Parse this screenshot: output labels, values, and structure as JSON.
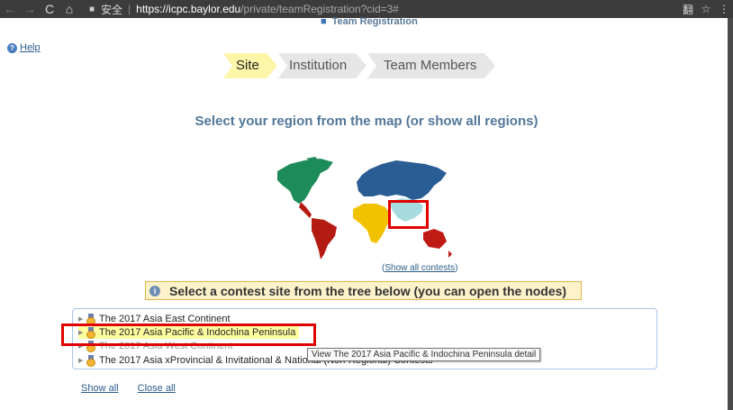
{
  "browser": {
    "secure_label": "安全",
    "url_host": "https://icpc.baylor.edu",
    "url_path": "/private/teamRegistration?cid=3#",
    "back_icon": "←",
    "forward_icon": "→",
    "reload_icon": "C",
    "home_icon": "⌂",
    "lock_icon": "🔒",
    "translate_icon": "翻",
    "star_icon": "☆",
    "menu_icon": "⋮"
  },
  "page": {
    "overlay_title": "Team Registration",
    "help_label": "Help"
  },
  "steps": [
    {
      "label": "Site",
      "active": true
    },
    {
      "label": "Institution",
      "active": false
    },
    {
      "label": "Team Members",
      "active": false
    }
  ],
  "region": {
    "heading": "Select your region from the map (or show all regions)",
    "show_all_contests_open": "(",
    "show_all_contests_link": "Show all contests",
    "show_all_contests_close": ")"
  },
  "info": {
    "text": "Select a contest site from the tree below (you can open the nodes)"
  },
  "tree": {
    "items": [
      {
        "label": "The 2017 Asia East Continent"
      },
      {
        "label": "The 2017 Asia Pacific & Indochina Peninsula"
      },
      {
        "label": "The 2017 Asia West Continent"
      },
      {
        "label": "The 2017 Asia xProvincial & Invitational & National (Non-Regional) Contests"
      }
    ],
    "tooltip": "View The 2017 Asia Pacific & Indochina Peninsula detail"
  },
  "links": {
    "show_all": "Show all",
    "close_all": "Close all"
  },
  "colors": {
    "map_north_america": "#1e8c5a",
    "map_south_america": "#b41b12",
    "map_europe_asia": "#2b5d95",
    "map_africa": "#f2c200",
    "map_southeast_asia": "#a6dce0",
    "map_oceania": "#c01a14",
    "highlight": "#e00000"
  }
}
